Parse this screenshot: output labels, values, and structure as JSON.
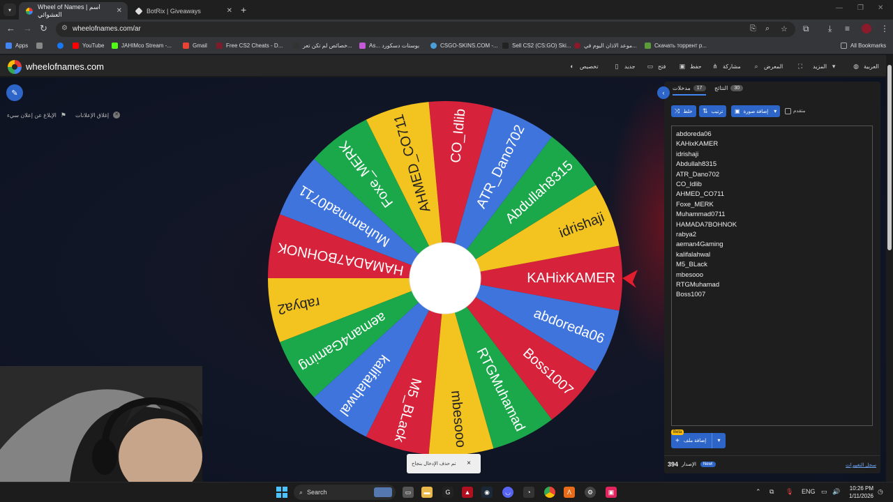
{
  "browser": {
    "tabs": [
      {
        "title": "Wheel of Names | اسم العشوائي",
        "active": true
      },
      {
        "title": "BotRix | Giveaways",
        "active": false
      }
    ],
    "url": "wheelofnames.com/ar",
    "bookmarks": [
      "Apps",
      "YouTube",
      "JAHIMco Stream -...",
      "Gmail",
      "Free CS2 Cheats - D...",
      "خصائص لم تكن تعر...",
      "As... بوستات دسكورد",
      "CSGO-SKINS.COM -...",
      "Sell CS2 (CS:GO) Ski...",
      "موعد الاذان اليوم في...",
      "Скачать торрент р..."
    ],
    "all_bookmarks": "All Bookmarks"
  },
  "site": {
    "name": "wheelofnames.com",
    "menu": {
      "customize": "تخصيص",
      "new": "جديد",
      "open": "فتح",
      "save": "حفظ",
      "share": "مشاركة",
      "gallery": "المعرض",
      "more": "المزيد",
      "language": "العربية"
    },
    "report_ad": "الإبلاغ عن إعلان سيء",
    "close_ads": "إغلاق الإعلانات"
  },
  "wheel": {
    "entries": [
      "KAHixKAMER",
      "idrishaji",
      "Abdullah8315",
      "ATR_Dano702",
      "CO_Idlib",
      "AHMED_CO711",
      "Foxe_MERK",
      "Muhammad0711",
      "HAMADA7BOHNOK",
      "rabya2",
      "aeman4Gaming",
      "kalifalahwal",
      "M5_BLack",
      "mbesooo",
      "RTGMuhamad",
      "Boss1007",
      "abdoreda06"
    ],
    "colors": [
      "#d6223a",
      "#f3c31f",
      "#1aa84a",
      "#3f74dd",
      "#d6223a",
      "#f3c31f",
      "#1aa84a",
      "#3f74dd",
      "#d6223a",
      "#f3c31f",
      "#1aa84a",
      "#3f74dd",
      "#d6223a",
      "#f3c31f",
      "#1aa84a",
      "#d6223a",
      "#3f74dd"
    ],
    "pointer_color": "#e11d2e"
  },
  "toast": {
    "text": "تم حذف الإدخال بنجاح",
    "close": "×"
  },
  "panel": {
    "tab_entries": "مدخلات",
    "tab_entries_count": "17",
    "tab_results": "النتائج",
    "tab_results_count": "30",
    "shuffle": "خلط",
    "sort": "ترتيب",
    "add_image": "إضافة صورة",
    "advanced": "متقدم",
    "entries": [
      "abdoreda06",
      "KAHixKAMER",
      "idrishaji",
      "Abdullah8315",
      "ATR_Dano702",
      "CO_Idlib",
      "AHMED_CO711",
      "Foxe_MERK",
      "Muhammad0711",
      "HAMADA7BOHNOK",
      "rabya2",
      "aeman4Gaming",
      "kalifalahwal",
      "M5_BLack",
      "mbesooo",
      "RTGMuhamad",
      "Boss1007"
    ],
    "add_sheet": "إضافة ملف",
    "beta": "Beta",
    "version_label": "الإصدار",
    "version": "394",
    "new_badge": "New!",
    "changelog": "سجل التغييرات"
  },
  "taskbar": {
    "search": "Search",
    "lang": "ENG",
    "time": "10:26 PM",
    "date": "1/11/2026"
  }
}
